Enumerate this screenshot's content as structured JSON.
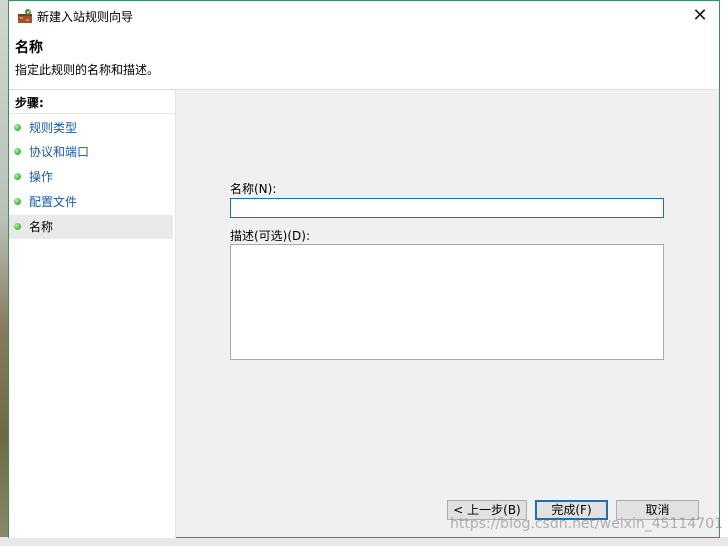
{
  "window": {
    "title": "新建入站规则向导",
    "close_glyph": "✕"
  },
  "header": {
    "title": "名称",
    "description": "指定此规则的名称和描述。"
  },
  "steps": {
    "title": "步骤:",
    "items": [
      {
        "label": "规则类型"
      },
      {
        "label": "协议和端口"
      },
      {
        "label": "操作"
      },
      {
        "label": "配置文件"
      },
      {
        "label": "名称"
      }
    ]
  },
  "form": {
    "name_label": "名称(N):",
    "name_value": "",
    "desc_label": "描述(可选)(D):",
    "desc_value": ""
  },
  "buttons": {
    "back": "< 上一步(B)",
    "finish": "完成(F)",
    "cancel": "取消"
  },
  "watermark": "https://blog.csdn.net/weixin_45114701",
  "icons": {
    "title": "firewall-wizard-icon",
    "step": "green-dot-icon"
  },
  "colors": {
    "accent": "#1b6fb5",
    "link": "#1a5aa8",
    "window_border": "#3b8e5e"
  }
}
